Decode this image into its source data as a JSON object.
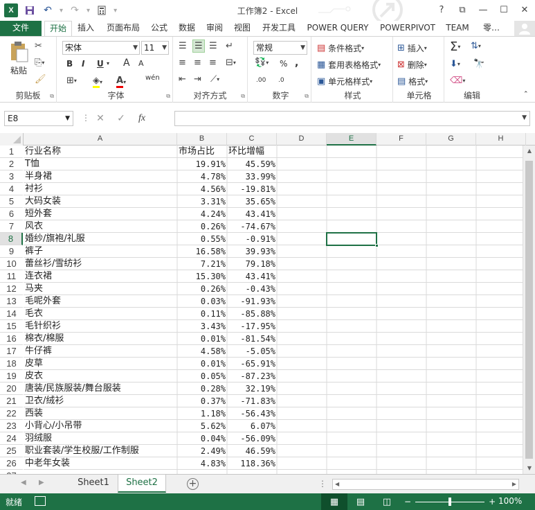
{
  "titlebar": {
    "title": "工作簿2 - Excel",
    "app_icon": "X",
    "help": "?",
    "restore_ribbon": "⧉",
    "minimize": "—",
    "maximize": "☐",
    "close": "✕"
  },
  "tabs": [
    "文件",
    "开始",
    "插入",
    "页面布局",
    "公式",
    "数据",
    "审阅",
    "视图",
    "开发工具",
    "POWER QUERY",
    "POWERPIVOT",
    "TEAM",
    "零…"
  ],
  "active_tab": "开始",
  "ribbon": {
    "clipboard": {
      "label": "剪贴板",
      "paste": "粘贴"
    },
    "font": {
      "label": "字体",
      "name": "宋体",
      "size": "11",
      "bold": "B",
      "italic": "I",
      "underline": "U",
      "grow": "A",
      "shrink": "A",
      "font_color_glyph": "A",
      "phonetic": "wén"
    },
    "alignment": {
      "label": "对齐方式"
    },
    "number": {
      "label": "数字",
      "format": "常规",
      "percent": "%",
      "comma": ",",
      "inc_dec": ".00",
      "dec_dec": ".0"
    },
    "styles": {
      "label": "样式",
      "conditional": "条件格式",
      "table": "套用表格格式",
      "cell_styles": "单元格样式"
    },
    "cells": {
      "label": "单元格",
      "insert": "插入",
      "delete": "删除",
      "format": "格式"
    },
    "editing": {
      "label": "编辑"
    }
  },
  "formula_bar": {
    "name_box": "E8",
    "fx": "fx",
    "cancel": "✕",
    "enter": "✓",
    "value": ""
  },
  "columns": [
    "A",
    "B",
    "C",
    "D",
    "E",
    "F",
    "G",
    "H"
  ],
  "selected_cell": {
    "col": "E",
    "row": 8
  },
  "rows": [
    {
      "n": 1,
      "a": "行业名称",
      "b": "市场占比",
      "c": "环比增幅"
    },
    {
      "n": 2,
      "a": "T恤",
      "b": "19.91%",
      "c": "45.59%"
    },
    {
      "n": 3,
      "a": "半身裙",
      "b": "4.78%",
      "c": "33.99%"
    },
    {
      "n": 4,
      "a": "衬衫",
      "b": "4.56%",
      "c": "-19.81%"
    },
    {
      "n": 5,
      "a": "大码女装",
      "b": "3.31%",
      "c": "35.65%"
    },
    {
      "n": 6,
      "a": "短外套",
      "b": "4.24%",
      "c": "43.41%"
    },
    {
      "n": 7,
      "a": "风衣",
      "b": "0.26%",
      "c": "-74.67%"
    },
    {
      "n": 8,
      "a": "婚纱/旗袍/礼服",
      "b": "0.55%",
      "c": "-0.91%"
    },
    {
      "n": 9,
      "a": "裤子",
      "b": "16.58%",
      "c": "39.93%"
    },
    {
      "n": 10,
      "a": "蕾丝衫/雪纺衫",
      "b": "7.21%",
      "c": "79.18%"
    },
    {
      "n": 11,
      "a": "连衣裙",
      "b": "15.30%",
      "c": "43.41%"
    },
    {
      "n": 12,
      "a": "马夹",
      "b": "0.26%",
      "c": "-0.43%"
    },
    {
      "n": 13,
      "a": "毛呢外套",
      "b": "0.03%",
      "c": "-91.93%"
    },
    {
      "n": 14,
      "a": "毛衣",
      "b": "0.11%",
      "c": "-85.88%"
    },
    {
      "n": 15,
      "a": "毛针织衫",
      "b": "3.43%",
      "c": "-17.95%"
    },
    {
      "n": 16,
      "a": "棉衣/棉服",
      "b": "0.01%",
      "c": "-81.54%"
    },
    {
      "n": 17,
      "a": "牛仔裤",
      "b": "4.58%",
      "c": "-5.05%"
    },
    {
      "n": 18,
      "a": "皮草",
      "b": "0.01%",
      "c": "-65.91%"
    },
    {
      "n": 19,
      "a": "皮衣",
      "b": "0.05%",
      "c": "-87.23%"
    },
    {
      "n": 20,
      "a": "唐装/民族服装/舞台服装",
      "b": "0.28%",
      "c": "32.19%"
    },
    {
      "n": 21,
      "a": "卫衣/绒衫",
      "b": "0.37%",
      "c": "-71.83%"
    },
    {
      "n": 22,
      "a": "西装",
      "b": "1.18%",
      "c": "-56.43%"
    },
    {
      "n": 23,
      "a": "小背心/小吊带",
      "b": "5.62%",
      "c": "6.07%"
    },
    {
      "n": 24,
      "a": "羽绒服",
      "b": "0.04%",
      "c": "-56.09%"
    },
    {
      "n": 25,
      "a": "职业套装/学生校服/工作制服",
      "b": "2.49%",
      "c": "46.59%"
    },
    {
      "n": 26,
      "a": "中老年女装",
      "b": "4.83%",
      "c": "118.36%"
    },
    {
      "n": 27,
      "a": "",
      "b": "",
      "c": ""
    }
  ],
  "sheets": [
    "Sheet1",
    "Sheet2"
  ],
  "active_sheet": "Sheet2",
  "statusbar": {
    "status": "就绪",
    "zoom": "100%",
    "zoom_minus": "−",
    "zoom_plus": "+",
    "zoom_fraction": 0.5
  }
}
